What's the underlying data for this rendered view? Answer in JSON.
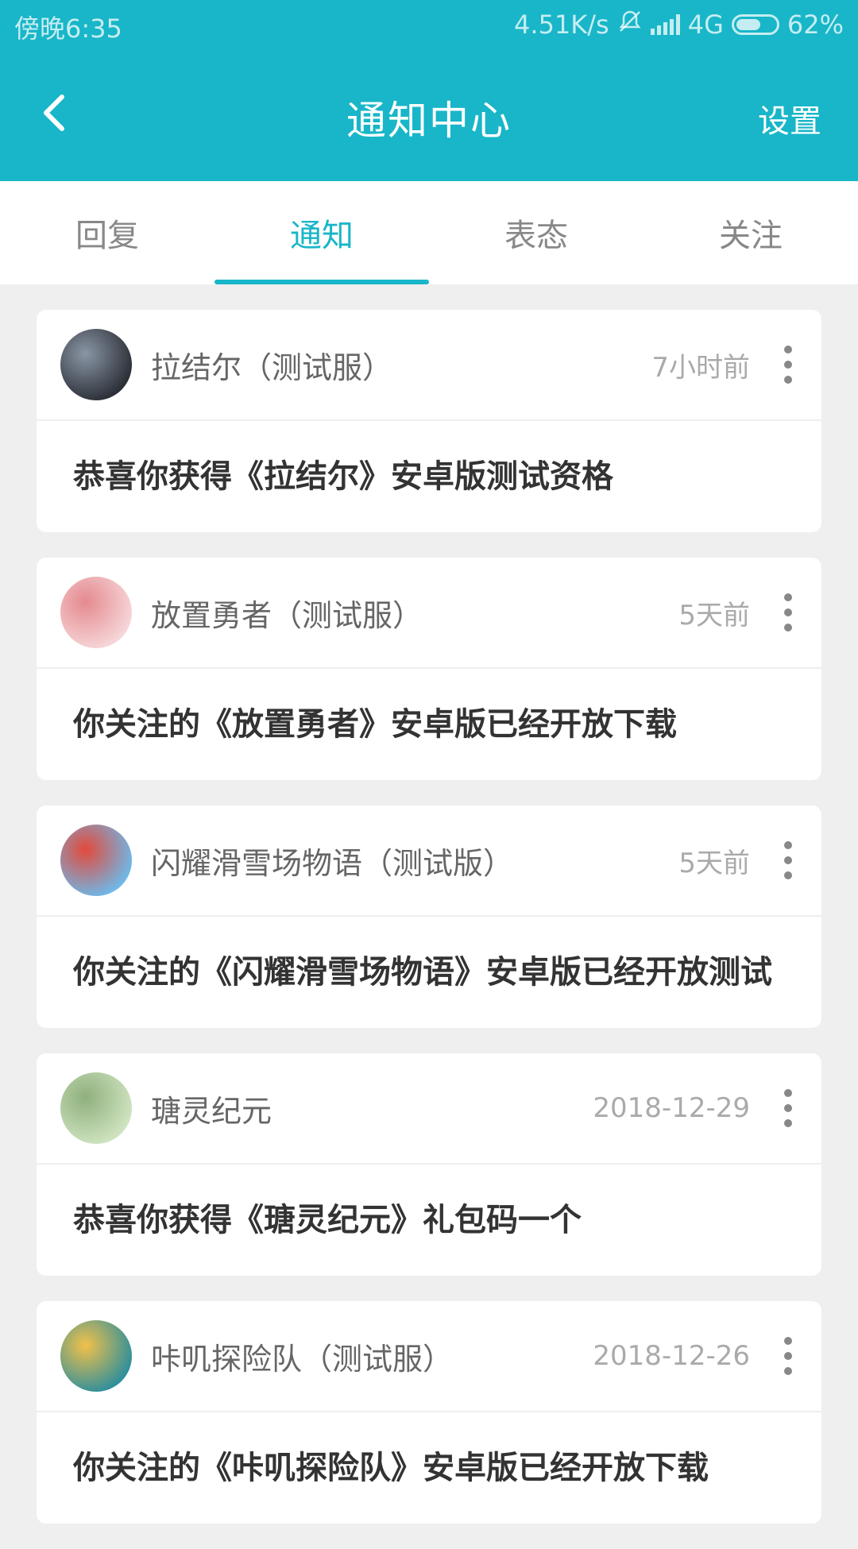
{
  "status_bar": {
    "time": "傍晚6:35",
    "net_speed": "4.51K/s",
    "network": "4G",
    "battery": "62%",
    "battery_level": 0.62
  },
  "app_bar": {
    "back_icon": "chevron-left-icon",
    "title": "通知中心",
    "settings": "设置"
  },
  "tabs": [
    {
      "label": "回复",
      "active": false
    },
    {
      "label": "通知",
      "active": true
    },
    {
      "label": "表态",
      "active": false
    },
    {
      "label": "关注",
      "active": false
    }
  ],
  "notifications": [
    {
      "game": "拉结尔（测试服）",
      "time": "7小时前",
      "message": "恭喜你获得《拉结尔》安卓版测试资格",
      "avatar_colors": [
        "#2b2f36",
        "#8a96a6"
      ]
    },
    {
      "game": "放置勇者（测试服）",
      "time": "5天前",
      "message": "你关注的《放置勇者》安卓版已经开放下载",
      "avatar_colors": [
        "#f6d6d9",
        "#e48a8e"
      ]
    },
    {
      "game": "闪耀滑雪场物语（测试版）",
      "time": "5天前",
      "message": "你关注的《闪耀滑雪场物语》安卓版已经开放测试",
      "avatar_colors": [
        "#6fb8e8",
        "#e24a3b"
      ]
    },
    {
      "game": "瑭灵纪元",
      "time": "2018-12-29",
      "message": "恭喜你获得《瑭灵纪元》礼包码一个",
      "avatar_colors": [
        "#cfe3c0",
        "#8fb07d"
      ]
    },
    {
      "game": "咔叽探险队（测试服）",
      "time": "2018-12-26",
      "message": "你关注的《咔叽探险队》安卓版已经开放下载",
      "avatar_colors": [
        "#2f8f9b",
        "#f2c14a"
      ]
    }
  ]
}
